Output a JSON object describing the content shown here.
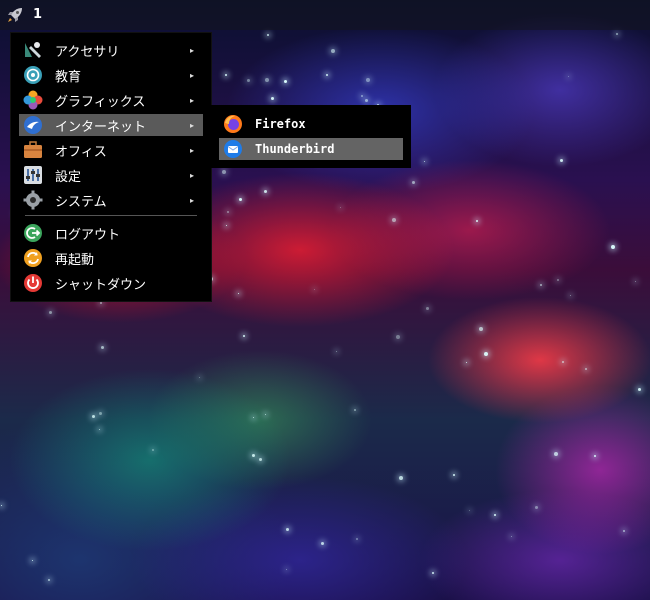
{
  "panel": {
    "launcher_icon": "rocket-icon",
    "workspace": "1"
  },
  "menu": {
    "categories": [
      {
        "label": "アクセサリ",
        "icon": "accessories-icon"
      },
      {
        "label": "教育",
        "icon": "education-icon"
      },
      {
        "label": "グラフィックス",
        "icon": "graphics-icon"
      },
      {
        "label": "インターネット",
        "icon": "internet-icon",
        "selected": true
      },
      {
        "label": "オフィス",
        "icon": "office-icon"
      },
      {
        "label": "設定",
        "icon": "settings-icon"
      },
      {
        "label": "システム",
        "icon": "system-icon"
      }
    ],
    "session": [
      {
        "label": "ログアウト",
        "icon": "logout-icon"
      },
      {
        "label": "再起動",
        "icon": "restart-icon"
      },
      {
        "label": "シャットダウン",
        "icon": "shutdown-icon"
      }
    ],
    "submenu_arrow": "▸"
  },
  "submenu": {
    "items": [
      {
        "label": "Firefox",
        "icon": "firefox-icon"
      },
      {
        "label": "Thunderbird",
        "icon": "thunderbird-icon",
        "selected": true
      }
    ]
  }
}
